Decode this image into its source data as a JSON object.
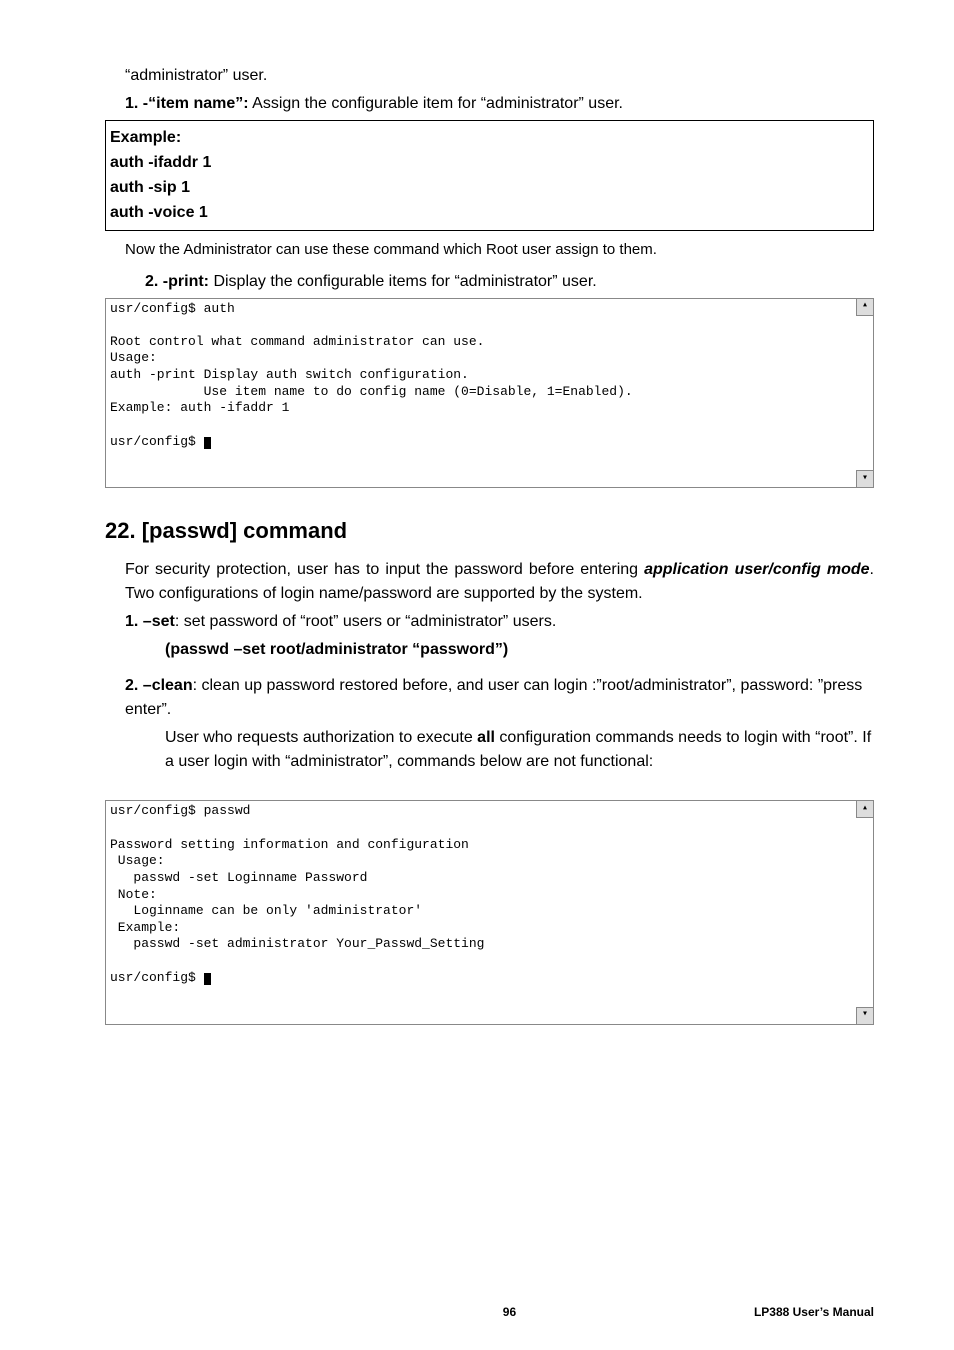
{
  "top": {
    "line1": "“administrator” user.",
    "item1_label": "1. -“item name”:",
    "item1_text": " Assign the configurable item for “administrator” user.",
    "example_title": "Example:",
    "example_cmd1": "auth -ifaddr 1",
    "example_cmd2": "auth -sip 1",
    "example_cmd3": "auth -voice 1",
    "note": "Now the Administrator can use these command which Root user assign to them.",
    "item2_label": "2.  -print:",
    "item2_text": " Display the configurable items for “administrator” user."
  },
  "terminal1": "usr/config$ auth\n\nRoot control what command administrator can use.\nUsage:\nauth -print Display auth switch configuration.\n            Use item name to do config name (0=Disable, 1=Enabled).\nExample: auth -ifaddr 1\n\nusr/config$ ",
  "section22": {
    "heading": "22. [passwd] command",
    "para1a": "For security protection, user has to input the password before entering ",
    "para1b": "application user/config mode",
    "para1c": ". Two configurations of login name/password are supported by the system.",
    "set_label": "1. –set",
    "set_text": ": set password of “root” users or “administrator” users.",
    "set_usage": "(passwd –set root/administrator “password”)",
    "clean_label": "2. –clean",
    "clean_text": ": clean up password restored before, and user can login :”root/administrator”, password: ”press enter”.",
    "tail_a": "User who requests authorization to execute ",
    "tail_b": "all",
    "tail_c": " configuration commands needs to login with “root”. If a user login with “administrator”, commands below are not functional:"
  },
  "terminal2": "usr/config$ passwd\n\nPassword setting information and configuration\n Usage:\n   passwd -set Loginname Password\n Note:\n   Loginname can be only 'administrator'\n Example:\n   passwd -set administrator Your_Passwd_Setting\n\nusr/config$ ",
  "footer": {
    "page": "96",
    "manual": "LP388  User’s  Manual"
  },
  "scroll_up_glyph": "▴",
  "scroll_down_glyph": "▾"
}
